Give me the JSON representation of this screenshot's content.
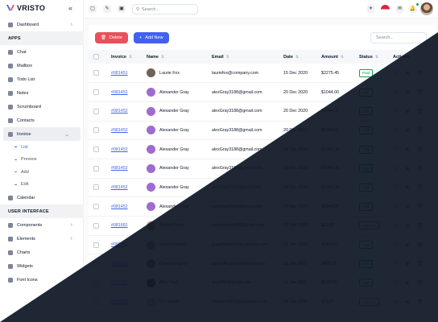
{
  "brand": {
    "name": "VRISTO",
    "accent": "#4361ee"
  },
  "sidebar": {
    "collapse_icon": "«",
    "items": [
      {
        "label": "Dashboard",
        "icon": "home-icon",
        "chevron": "›"
      },
      {
        "section": "APPS"
      },
      {
        "label": "Chat",
        "icon": "chat-icon"
      },
      {
        "label": "Mailbox",
        "icon": "mail-icon"
      },
      {
        "label": "Todo List",
        "icon": "todo-icon"
      },
      {
        "label": "Notes",
        "icon": "notes-icon"
      },
      {
        "label": "Scrumboard",
        "icon": "board-icon"
      },
      {
        "label": "Contacts",
        "icon": "contacts-icon"
      },
      {
        "label": "Invoice",
        "icon": "invoice-icon",
        "chevron": "⌄",
        "active": true
      },
      {
        "sub": "List",
        "active": true
      },
      {
        "sub": "Preview"
      },
      {
        "sub": "Add"
      },
      {
        "sub": "Edit"
      },
      {
        "label": "Calendar",
        "icon": "calendar-icon"
      },
      {
        "section": "USER INTERFACE"
      },
      {
        "label": "Components",
        "icon": "components-icon",
        "chevron": "›"
      },
      {
        "label": "Elements",
        "icon": "elements-icon",
        "chevron": "›"
      },
      {
        "label": "Charts",
        "icon": "charts-icon"
      },
      {
        "label": "Widgets",
        "icon": "widgets-icon"
      },
      {
        "label": "Font Icons",
        "icon": "font-icons-icon"
      }
    ]
  },
  "topbar": {
    "search_placeholder": "Search..."
  },
  "toolbar": {
    "delete_label": "Delete",
    "add_label": "Add New",
    "search_placeholder": "Search..."
  },
  "table": {
    "columns": [
      "Invoice",
      "Name",
      "Email",
      "Date",
      "Amount",
      "Status",
      "Actions"
    ],
    "rows": [
      {
        "invoice": "#081451",
        "name": "Laurie Fox",
        "email": "lauriefox@company.com",
        "date": "15 Dec 2020",
        "amount": "$2275.45",
        "status": "Paid",
        "avatar_color": "#6f6256"
      },
      {
        "invoice": "#081452",
        "name": "Alexander Gray",
        "email": "alexGray3188@gmail.com",
        "date": "20 Dec 2020",
        "amount": "$1044.00",
        "status": "Paid",
        "avatar_color": "#9f6bd1"
      },
      {
        "invoice": "#081452",
        "name": "Alexander Gray",
        "email": "alexGray3188@gmail.com",
        "date": "20 Dec 2020",
        "amount": "$1044.00",
        "status": "Paid",
        "avatar_color": "#9f6bd1"
      },
      {
        "invoice": "#081452",
        "name": "Alexander Gray",
        "email": "alexGray3188@gmail.com",
        "date": "20 Dec 2020",
        "amount": "$1044.00",
        "status": "Paid",
        "avatar_color": "#9f6bd1"
      },
      {
        "invoice": "#081452",
        "name": "Alexander Gray",
        "email": "alexGray3188@gmail.com",
        "date": "20 Dec 2020",
        "amount": "$1044.00",
        "status": "Paid",
        "avatar_color": "#9f6bd1"
      },
      {
        "invoice": "#081452",
        "name": "Alexander Gray",
        "email": "alexGray3188@gmail.com",
        "date": "20 Dec 2020",
        "amount": "$1044.00",
        "status": "Paid",
        "avatar_color": "#9f6bd1"
      },
      {
        "invoice": "#081452",
        "name": "Alexander Gray",
        "email": "alexGray3188@gmail.com",
        "date": "20 Dec 2020",
        "amount": "$1044.00",
        "status": "Paid",
        "avatar_color": "#9f6bd1"
      },
      {
        "invoice": "#081452",
        "name": "Alexander Gray",
        "email": "alexGray3188@gmail.com",
        "date": "20 Dec 2020",
        "amount": "$1044.00",
        "status": "Paid",
        "avatar_color": "#9f6bd1"
      },
      {
        "invoice": "#081681",
        "name": "James Taylor",
        "email": "jamestaylor468@gmail.com",
        "date": "27 Dec 2020",
        "amount": "$20.00",
        "status": "Pending",
        "avatar_color": "#b58b6a"
      },
      {
        "invoice": "#082693",
        "name": "Grace Roberts",
        "email": "graceRoberts@company.com",
        "date": "31 Dec 2020",
        "amount": "$344.00",
        "status": "Paid",
        "avatar_color": "#c48a7a"
      },
      {
        "invoice": "#084743",
        "name": "Donna Rogers",
        "email": "donnaRogers@hotmail.com",
        "date": "03 Jan 2021",
        "amount": "$405.15",
        "status": "Paid",
        "avatar_color": "#8a6c5c"
      },
      {
        "invoice": "#086580",
        "name": "Amy Diaz",
        "email": "amy968@gmail.com",
        "date": "14 Jan 2020",
        "amount": "$100.00",
        "status": "Paid",
        "avatar_color": "#5a4d46"
      },
      {
        "invoice": "#086673",
        "name": "Nia Hillyer",
        "email": "niahillyer666@comapny.com",
        "date": "20 Jan 2021",
        "amount": "$59.21",
        "status": "Pending",
        "avatar_color": "#d8b59c"
      }
    ]
  },
  "colors": {
    "paid": "#00ab55",
    "pending": "#e7515a",
    "dark_bg": "#0e1726"
  }
}
